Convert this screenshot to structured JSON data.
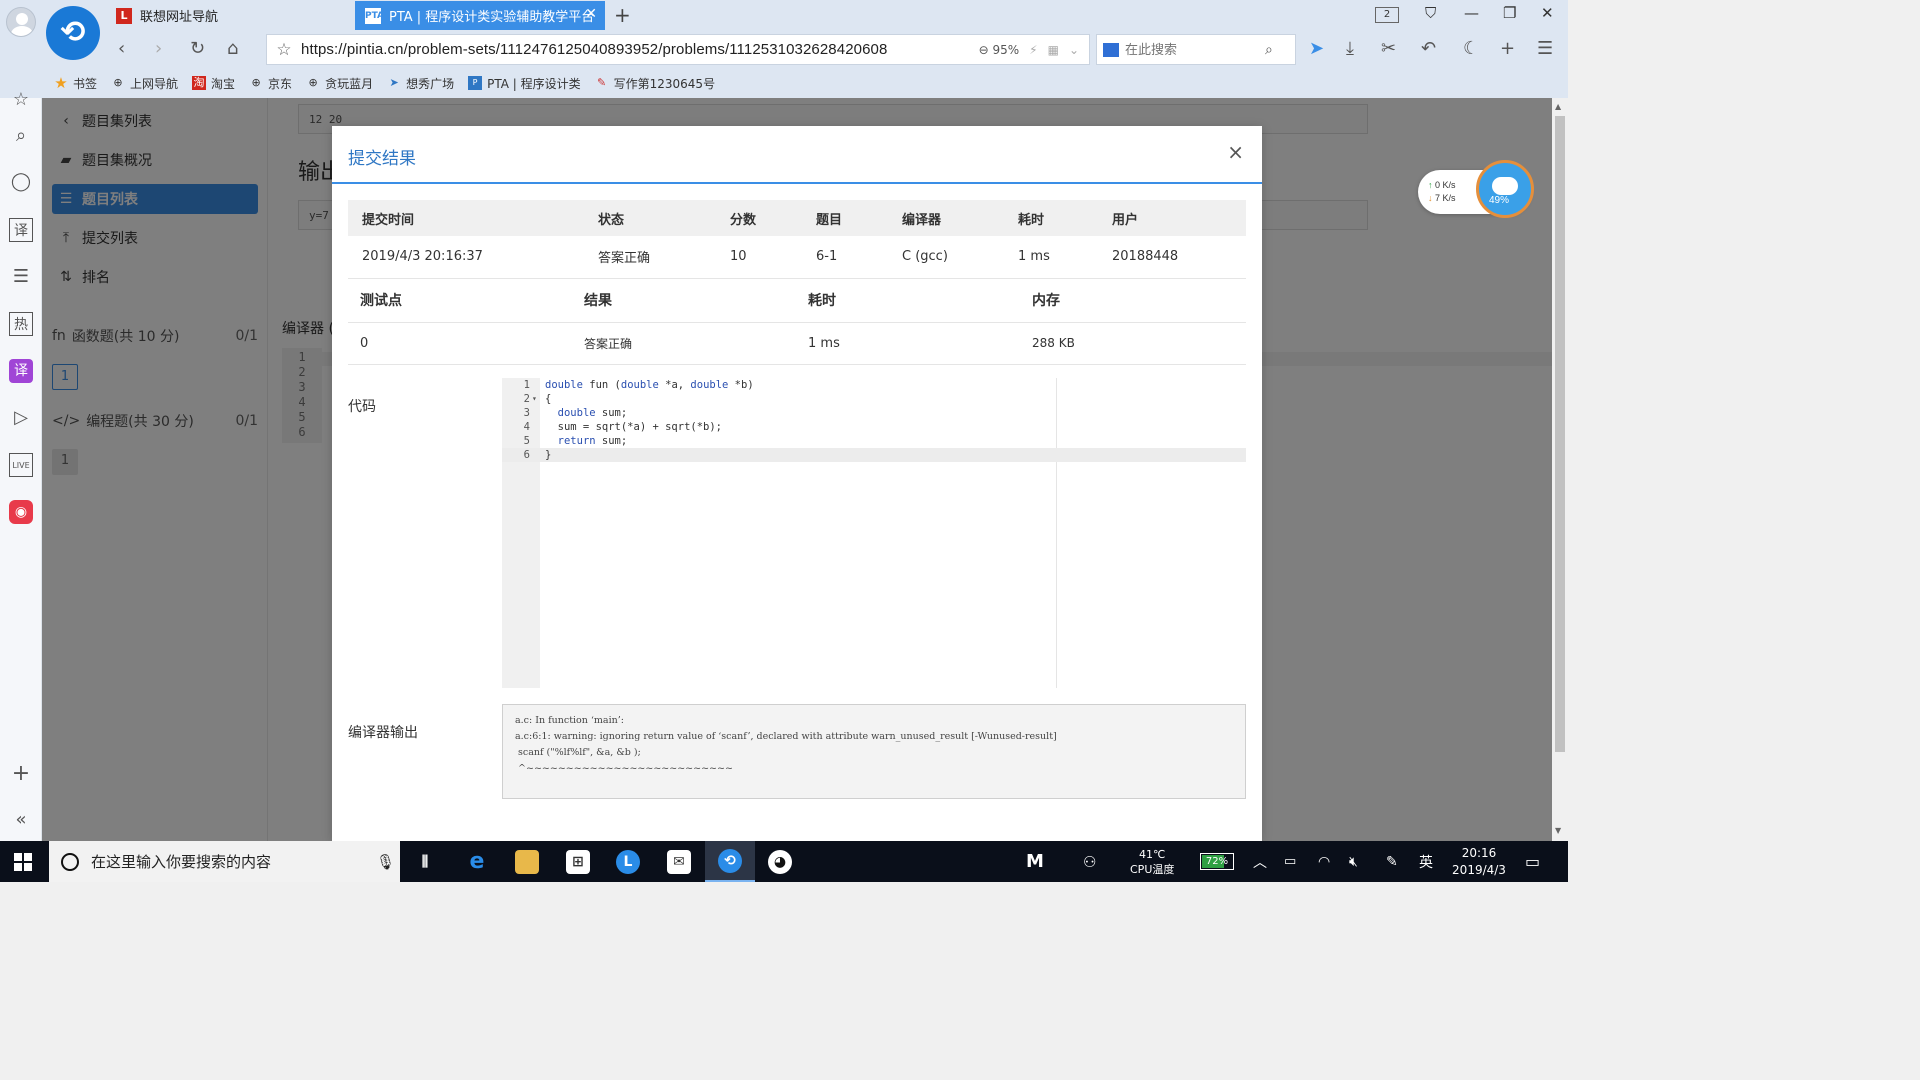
{
  "browser": {
    "tabs": [
      {
        "label": "联想网址导航",
        "favicon": "L"
      },
      {
        "label": "PTA | 程序设计类实验辅助教学平台",
        "favicon": "PTA"
      }
    ],
    "tab_count": "2",
    "url": "https://pintia.cn/problem-sets/1112476125040893952/problems/1112531032628420608",
    "zoom": "95%",
    "search_placeholder": "在此搜索",
    "bookmarks": [
      "书签",
      "上网导航",
      "淘宝",
      "京东",
      "贪玩蓝月",
      "想秀广场",
      "PTA | 程序设计类",
      "写作第1230645号"
    ],
    "sidebar_icons": [
      "star-icon",
      "search-icon",
      "chat-icon",
      "translate-icon",
      "server-icon",
      "hot-icon",
      "translator-app-icon",
      "video-icon",
      "live-icon",
      "app-icon",
      "plus-icon",
      "collapse-icon"
    ]
  },
  "page_nav": {
    "back": "题目集列表",
    "items": [
      "题目集概况",
      "题目列表",
      "提交列表",
      "排名"
    ],
    "sections": [
      {
        "label": "函数题(共 10 分)",
        "count": "0/1",
        "problem": "1"
      },
      {
        "label": "编程题(共 30 分)",
        "count": "0/1",
        "problem": "1"
      }
    ]
  },
  "page_bg": {
    "sample_input": "12 20",
    "output_title": "输出",
    "output_sample": "y=7",
    "compiler_label": "编译器 (",
    "gutter_lines": [
      "1",
      "2",
      "3",
      "4",
      "5",
      "6"
    ]
  },
  "net_widget": {
    "up": "0  K/s",
    "down": "7  K/s",
    "cpu": "49%"
  },
  "modal": {
    "title": "提交结果",
    "close": "×",
    "submission_headers": [
      "提交时间",
      "状态",
      "分数",
      "题目",
      "编译器",
      "耗时",
      "用户"
    ],
    "submission": {
      "time": "2019/4/3 20:16:37",
      "status": "答案正确",
      "score": "10",
      "problem": "6-1",
      "compiler": "C (gcc)",
      "elapsed": "1 ms",
      "user": "20188448"
    },
    "test_headers": [
      "测试点",
      "结果",
      "耗时",
      "内存"
    ],
    "test": {
      "point": "0",
      "result": "答案正确",
      "elapsed": "1 ms",
      "memory": "288 KB"
    },
    "code_label": "代码",
    "code_lines": [
      "double fun (double *a, double *b)",
      "{",
      "  double sum;",
      "  sum = sqrt(*a) + sqrt(*b);",
      "  return sum;",
      "}"
    ],
    "compiler_label": "编译器输出",
    "compiler_output": "a.c: In function ‘main’:\na.c:6:1: warning: ignoring return value of ‘scanf’, declared with attribute warn_unused_result [-Wunused-result]\n scanf (\"%lf%lf\", &a, &b );\n ^~~~~~~~~~~~~~~~~~~~~~~~~~~"
  },
  "taskbar": {
    "search_placeholder": "在这里输入你要搜索的内容",
    "temperature": "41℃",
    "temperature_label": "CPU温度",
    "battery": "72%",
    "ime": "英",
    "time": "20:16",
    "date": "2019/4/3"
  },
  "colors": {
    "accent": "#3a8ee6",
    "status_ok": "#e0453b",
    "taskbar": "#0a0f1a"
  }
}
